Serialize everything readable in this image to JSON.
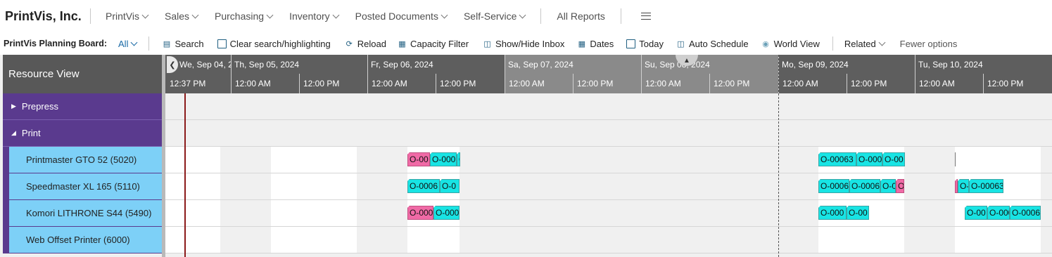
{
  "app": {
    "company": "PrintVis, Inc.",
    "nav": [
      {
        "label": "PrintVis"
      },
      {
        "label": "Sales"
      },
      {
        "label": "Purchasing"
      },
      {
        "label": "Inventory"
      },
      {
        "label": "Posted Documents"
      },
      {
        "label": "Self-Service"
      }
    ],
    "all_reports": "All Reports",
    "menu_icon": "hamburger-icon"
  },
  "actionbar": {
    "page_title": "PrintVis Planning Board:",
    "filter_value": "All",
    "actions": [
      {
        "label": "Search",
        "icon": "search-icon"
      },
      {
        "label": "Clear search/highlighting",
        "icon": "clear-icon"
      },
      {
        "label": "Reload",
        "icon": "reload-icon"
      },
      {
        "label": "Capacity Filter",
        "icon": "filter-icon"
      },
      {
        "label": "Show/Hide Inbox",
        "icon": "inbox-icon"
      },
      {
        "label": "Dates",
        "icon": "calendar-icon"
      },
      {
        "label": "Today",
        "icon": "today-icon"
      },
      {
        "label": "Auto Schedule",
        "icon": "schedule-icon"
      },
      {
        "label": "World View",
        "icon": "eye-icon"
      }
    ],
    "related": "Related",
    "fewer_options": "Fewer options"
  },
  "board": {
    "resource_view_title": "Resource View",
    "groups": [
      {
        "label": "Prepress",
        "expanded": false
      },
      {
        "label": "Print",
        "expanded": true
      }
    ],
    "resources": [
      {
        "label": "Printmaster GTO 52 (5020)"
      },
      {
        "label": "Speedmaster XL 165 (5110)"
      },
      {
        "label": "Komori LITHRONE S44 (5490)"
      },
      {
        "label": "Web Offset Printer (6000)"
      }
    ],
    "days": [
      {
        "label": "We, Sep 04, 2024"
      },
      {
        "label": "Th, Sep 05, 2024"
      },
      {
        "label": "Fr, Sep 06, 2024"
      },
      {
        "label": "Sa, Sep 07, 2024"
      },
      {
        "label": "Su, Sep 08, 2024"
      },
      {
        "label": "Mo, Sep 09, 2024"
      },
      {
        "label": "Tu, Sep 10, 2024"
      }
    ],
    "hours": [
      "12:37 PM",
      "12:00 AM",
      "12:00 PM",
      "12:00 AM",
      "12:00 PM",
      "12:00 AM",
      "12:00 PM",
      "12:00 AM",
      "12:00 PM",
      "12:00 AM",
      "12:00 PM",
      "12:00 AM",
      "12:00 PM"
    ],
    "jobs": {
      "r0": [
        "O-00",
        "O-000",
        "O",
        "O-00063",
        "O-000",
        "O-00"
      ],
      "r1": [
        "O-0006",
        "O-0",
        "O-0006",
        "O-0006",
        "O-0",
        "O",
        "O-",
        "O-00063"
      ],
      "r2": [
        "O-000",
        "O-000",
        "O-000",
        "O-00",
        "O-00",
        "O-000",
        "O-0006"
      ]
    },
    "colors": {
      "group_bg": "#5a3a8e",
      "resource_bg": "#7dd0f7",
      "job_cyan": "#18e4e4",
      "job_pink": "#f06aa6",
      "now_line": "#8b1a1a"
    }
  }
}
